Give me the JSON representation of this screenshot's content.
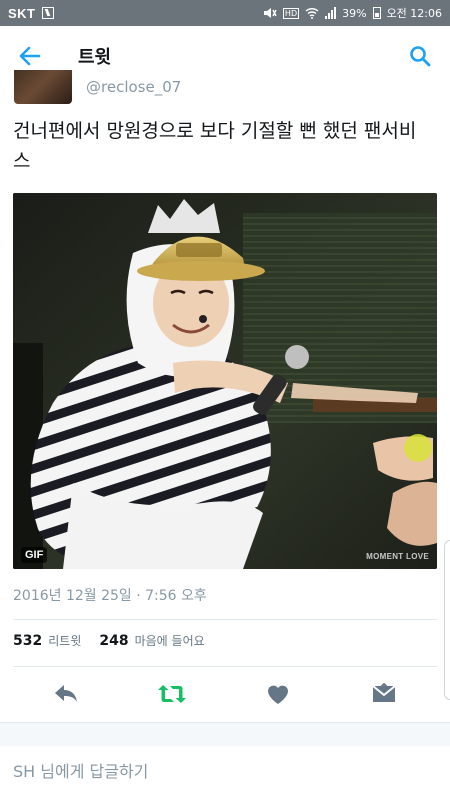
{
  "status_bar": {
    "carrier": "SKT",
    "battery": "39%",
    "time": "오전 12:06",
    "hd_label": "HD"
  },
  "app_bar": {
    "title": "트윗",
    "back_icon": "arrow-left-icon",
    "search_icon": "search-icon"
  },
  "tweet": {
    "author_handle": "@reclose_07",
    "text": "건너편에서 망원경으로 보다 기절할 뻔 했던 팬서비스",
    "media_badge": "GIF",
    "media_watermark": "MOMENT LOVE",
    "timestamp": "2016년 12월 25일 · 7:56 오후",
    "retweets_count": "532",
    "retweets_label": "리트윗",
    "likes_count": "248",
    "likes_label": "마음에 들어요"
  },
  "actions": {
    "reply_icon": "reply-icon",
    "retweet_icon": "retweet-icon",
    "like_icon": "heart-icon",
    "dm_icon": "envelope-icon"
  },
  "reply_box": {
    "placeholder": "SH 님에게 답글하기"
  },
  "colors": {
    "accent": "#1da1f2",
    "retweet_green": "#17bf63",
    "icon_gray": "#657786",
    "status_bar": "#6b737b"
  }
}
